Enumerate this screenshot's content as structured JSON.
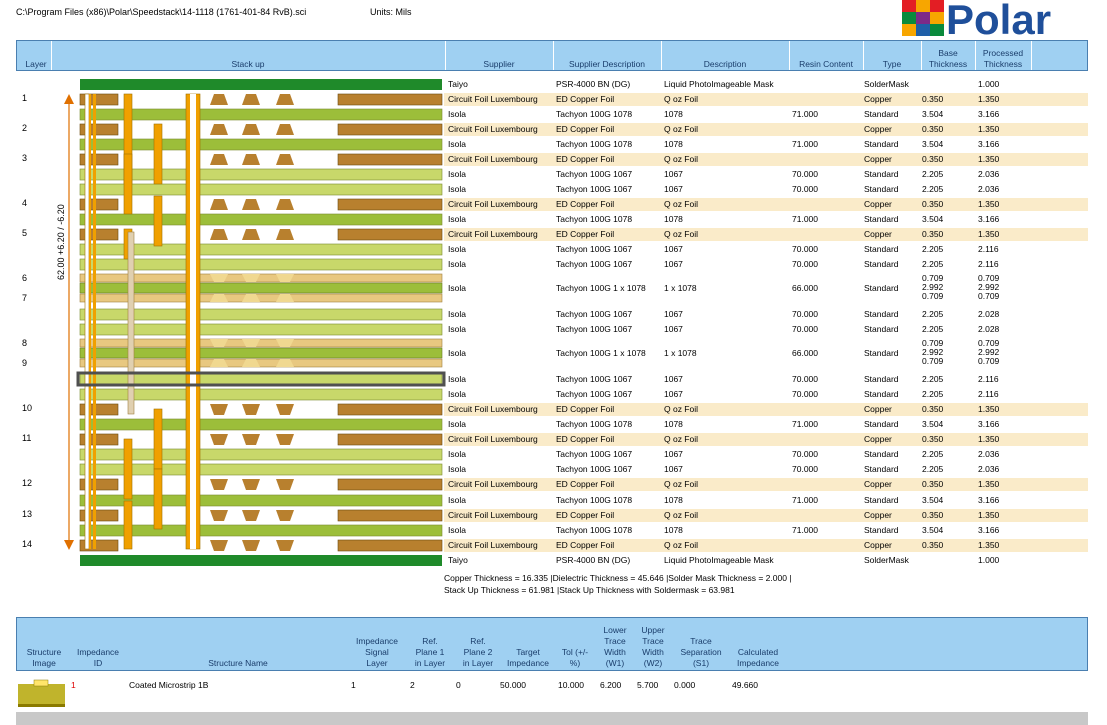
{
  "file_path": "C:\\Program Files (x86)\\Polar\\Speedstack\\14-1118 (1761-401-84 RvB).sci",
  "units": "Units: Mils",
  "logo_text": "Polar",
  "headers": {
    "layer": "Layer",
    "stackup": "Stack up",
    "supplier": "Supplier",
    "supplier_desc": "Supplier Description",
    "description": "Description",
    "resin": "Resin Content",
    "type": "Type",
    "base1": "Base",
    "base2": "Thickness",
    "proc1": "Processed",
    "proc2": "Thickness"
  },
  "layer_labels": [
    "1",
    "2",
    "3",
    "4",
    "5",
    "6",
    "7",
    "8",
    "9",
    "10",
    "11",
    "12",
    "13",
    "14"
  ],
  "dimension_label": "62.00 +6.20 / -6.20",
  "rows": [
    {
      "supplier": "Taiyo",
      "sdesc": "PSR-4000 BN (DG)",
      "desc": "Liquid PhotoImageable Mask",
      "resin": "",
      "type": "SolderMask",
      "base": "",
      "proc": "1.000",
      "cu": false
    },
    {
      "supplier": "Circuit Foil Luxembourg",
      "sdesc": "ED Copper Foil",
      "desc": "Q oz Foil",
      "resin": "",
      "type": "Copper",
      "base": "0.350",
      "proc": "1.350",
      "cu": true
    },
    {
      "supplier": "Isola",
      "sdesc": "Tachyon 100G 1078",
      "desc": "1078",
      "resin": "71.000",
      "type": "Standard",
      "base": "3.504",
      "proc": "3.166",
      "cu": false
    },
    {
      "supplier": "Circuit Foil Luxembourg",
      "sdesc": "ED Copper Foil",
      "desc": "Q oz Foil",
      "resin": "",
      "type": "Copper",
      "base": "0.350",
      "proc": "1.350",
      "cu": true
    },
    {
      "supplier": "Isola",
      "sdesc": "Tachyon 100G 1078",
      "desc": "1078",
      "resin": "71.000",
      "type": "Standard",
      "base": "3.504",
      "proc": "3.166",
      "cu": false
    },
    {
      "supplier": "Circuit Foil Luxembourg",
      "sdesc": "ED Copper Foil",
      "desc": "Q oz Foil",
      "resin": "",
      "type": "Copper",
      "base": "0.350",
      "proc": "1.350",
      "cu": true
    },
    {
      "supplier": "Isola",
      "sdesc": "Tachyon 100G 1067",
      "desc": "1067",
      "resin": "70.000",
      "type": "Standard",
      "base": "2.205",
      "proc": "2.036",
      "cu": false
    },
    {
      "supplier": "Isola",
      "sdesc": "Tachyon 100G 1067",
      "desc": "1067",
      "resin": "70.000",
      "type": "Standard",
      "base": "2.205",
      "proc": "2.036",
      "cu": false
    },
    {
      "supplier": "Circuit Foil Luxembourg",
      "sdesc": "ED Copper Foil",
      "desc": "Q oz Foil",
      "resin": "",
      "type": "Copper",
      "base": "0.350",
      "proc": "1.350",
      "cu": true
    },
    {
      "supplier": "Isola",
      "sdesc": "Tachyon 100G 1078",
      "desc": "1078",
      "resin": "71.000",
      "type": "Standard",
      "base": "3.504",
      "proc": "3.166",
      "cu": false
    },
    {
      "supplier": "Circuit Foil Luxembourg",
      "sdesc": "ED Copper Foil",
      "desc": "Q oz Foil",
      "resin": "",
      "type": "Copper",
      "base": "0.350",
      "proc": "1.350",
      "cu": true
    },
    {
      "supplier": "Isola",
      "sdesc": "Tachyon 100G 1067",
      "desc": "1067",
      "resin": "70.000",
      "type": "Standard",
      "base": "2.205",
      "proc": "2.116",
      "cu": false
    },
    {
      "supplier": "Isola",
      "sdesc": "Tachyon 100G 1067",
      "desc": "1067",
      "resin": "70.000",
      "type": "Standard",
      "base": "2.205",
      "proc": "2.116",
      "cu": false
    },
    {
      "supplier": "Isola",
      "sdesc": "Tachyon 100G 1 x 1078",
      "desc": "1 x 1078",
      "resin": "66.000",
      "type": "Standard",
      "base": "0.709\n2.992\n0.709",
      "proc": "0.709\n2.992\n0.709",
      "cu": false,
      "triple": true
    },
    {
      "supplier": "Isola",
      "sdesc": "Tachyon 100G 1067",
      "desc": "1067",
      "resin": "70.000",
      "type": "Standard",
      "base": "2.205",
      "proc": "2.028",
      "cu": false
    },
    {
      "supplier": "Isola",
      "sdesc": "Tachyon 100G 1067",
      "desc": "1067",
      "resin": "70.000",
      "type": "Standard",
      "base": "2.205",
      "proc": "2.028",
      "cu": false
    },
    {
      "supplier": "Isola",
      "sdesc": "Tachyon 100G 1 x 1078",
      "desc": "1 x 1078",
      "resin": "66.000",
      "type": "Standard",
      "base": "0.709\n2.992\n0.709",
      "proc": "0.709\n2.992\n0.709",
      "cu": false,
      "triple": true
    },
    {
      "supplier": "Isola",
      "sdesc": "Tachyon 100G 1067",
      "desc": "1067",
      "resin": "70.000",
      "type": "Standard",
      "base": "2.205",
      "proc": "2.116",
      "cu": false
    },
    {
      "supplier": "Isola",
      "sdesc": "Tachyon 100G 1067",
      "desc": "1067",
      "resin": "70.000",
      "type": "Standard",
      "base": "2.205",
      "proc": "2.116",
      "cu": false
    },
    {
      "supplier": "Circuit Foil Luxembourg",
      "sdesc": "ED Copper Foil",
      "desc": "Q oz Foil",
      "resin": "",
      "type": "Copper",
      "base": "0.350",
      "proc": "1.350",
      "cu": true
    },
    {
      "supplier": "Isola",
      "sdesc": "Tachyon 100G 1078",
      "desc": "1078",
      "resin": "71.000",
      "type": "Standard",
      "base": "3.504",
      "proc": "3.166",
      "cu": false
    },
    {
      "supplier": "Circuit Foil Luxembourg",
      "sdesc": "ED Copper Foil",
      "desc": "Q oz Foil",
      "resin": "",
      "type": "Copper",
      "base": "0.350",
      "proc": "1.350",
      "cu": true
    },
    {
      "supplier": "Isola",
      "sdesc": "Tachyon 100G 1067",
      "desc": "1067",
      "resin": "70.000",
      "type": "Standard",
      "base": "2.205",
      "proc": "2.036",
      "cu": false
    },
    {
      "supplier": "Isola",
      "sdesc": "Tachyon 100G 1067",
      "desc": "1067",
      "resin": "70.000",
      "type": "Standard",
      "base": "2.205",
      "proc": "2.036",
      "cu": false
    },
    {
      "supplier": "Circuit Foil Luxembourg",
      "sdesc": "ED Copper Foil",
      "desc": "Q oz Foil",
      "resin": "",
      "type": "Copper",
      "base": "0.350",
      "proc": "1.350",
      "cu": true
    },
    {
      "supplier": "Isola",
      "sdesc": "Tachyon 100G 1078",
      "desc": "1078",
      "resin": "71.000",
      "type": "Standard",
      "base": "3.504",
      "proc": "3.166",
      "cu": false
    },
    {
      "supplier": "Circuit Foil Luxembourg",
      "sdesc": "ED Copper Foil",
      "desc": "Q oz Foil",
      "resin": "",
      "type": "Copper",
      "base": "0.350",
      "proc": "1.350",
      "cu": true
    },
    {
      "supplier": "Isola",
      "sdesc": "Tachyon 100G 1078",
      "desc": "1078",
      "resin": "71.000",
      "type": "Standard",
      "base": "3.504",
      "proc": "3.166",
      "cu": false
    },
    {
      "supplier": "Circuit Foil Luxembourg",
      "sdesc": "ED Copper Foil",
      "desc": "Q oz Foil",
      "resin": "",
      "type": "Copper",
      "base": "0.350",
      "proc": "1.350",
      "cu": true
    },
    {
      "supplier": "Taiyo",
      "sdesc": "PSR-4000 BN (DG)",
      "desc": "Liquid PhotoImageable Mask",
      "resin": "",
      "type": "SolderMask",
      "base": "",
      "proc": "1.000",
      "cu": false
    }
  ],
  "summary_line1": "Copper Thickness = 16.335  |Dielectric Thickness = 45.646  |Solder Mask Thickness = 2.000  |",
  "summary_line2": "Stack Up Thickness = 61.981  |Stack Up Thickness with Soldermask = 63.981",
  "imp_headers": {
    "struct_image": "Structure\nImage",
    "imp_id": "Impedance\nID",
    "struct_name": "Structure Name",
    "signal": "Impedance\nSignal\nLayer",
    "ref1": "Ref.\nPlane 1\nin Layer",
    "ref2": "Ref.\nPlane 2\nin Layer",
    "target": "Target\nImpedance",
    "tol": "Tol (+/-\n%)",
    "lower": "Lower\nTrace\nWidth\n(W1)",
    "upper": "Upper\nTrace\nWidth\n(W2)",
    "sep": "Trace\nSeparation\n(S1)",
    "calc": "Calculated\nImpedance"
  },
  "imp_rows": [
    {
      "id": "1",
      "name": "Coated Microstrip 1B",
      "signal": "1",
      "ref1": "2",
      "ref2": "0",
      "target": "50.000",
      "tol": "10.000",
      "lower": "6.200",
      "upper": "5.700",
      "sep": "0.000",
      "calc": "49.660"
    }
  ],
  "colors": {
    "header_bg": "#9fd0f2",
    "copper_row": "#faebc9",
    "copper": "#b8802e",
    "prepreg": "#c8d86a",
    "core": "#9cbe3a",
    "soldermask": "#1f8a2a",
    "via": "#f0a000"
  }
}
